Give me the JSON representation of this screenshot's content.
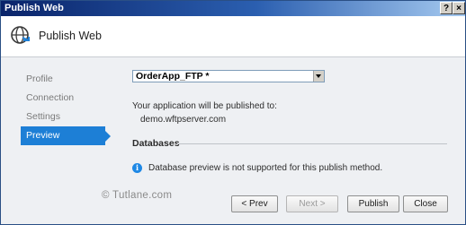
{
  "window": {
    "title": "Publish Web",
    "help_glyph": "?",
    "close_glyph": "×"
  },
  "header": {
    "title": "Publish Web",
    "icon": "globe-publish-icon"
  },
  "sidebar": {
    "items": [
      {
        "label": "Profile",
        "active": false
      },
      {
        "label": "Connection",
        "active": false
      },
      {
        "label": "Settings",
        "active": false
      },
      {
        "label": "Preview",
        "active": true
      }
    ]
  },
  "profile_select": {
    "value": "OrderApp_FTP *"
  },
  "main": {
    "publish_target_text": "Your application will be published to:",
    "server": "demo.wftpserver.com",
    "databases_heading": "Databases",
    "databases_note": "Database preview is not supported for this publish method.",
    "info_glyph": "i"
  },
  "watermark": "© Tutlane.com",
  "buttons": {
    "prev": "< Prev",
    "next": "Next >",
    "publish": "Publish",
    "close": "Close"
  },
  "colors": {
    "accent": "#1d7fd6",
    "titlebar": "#0a246a"
  }
}
